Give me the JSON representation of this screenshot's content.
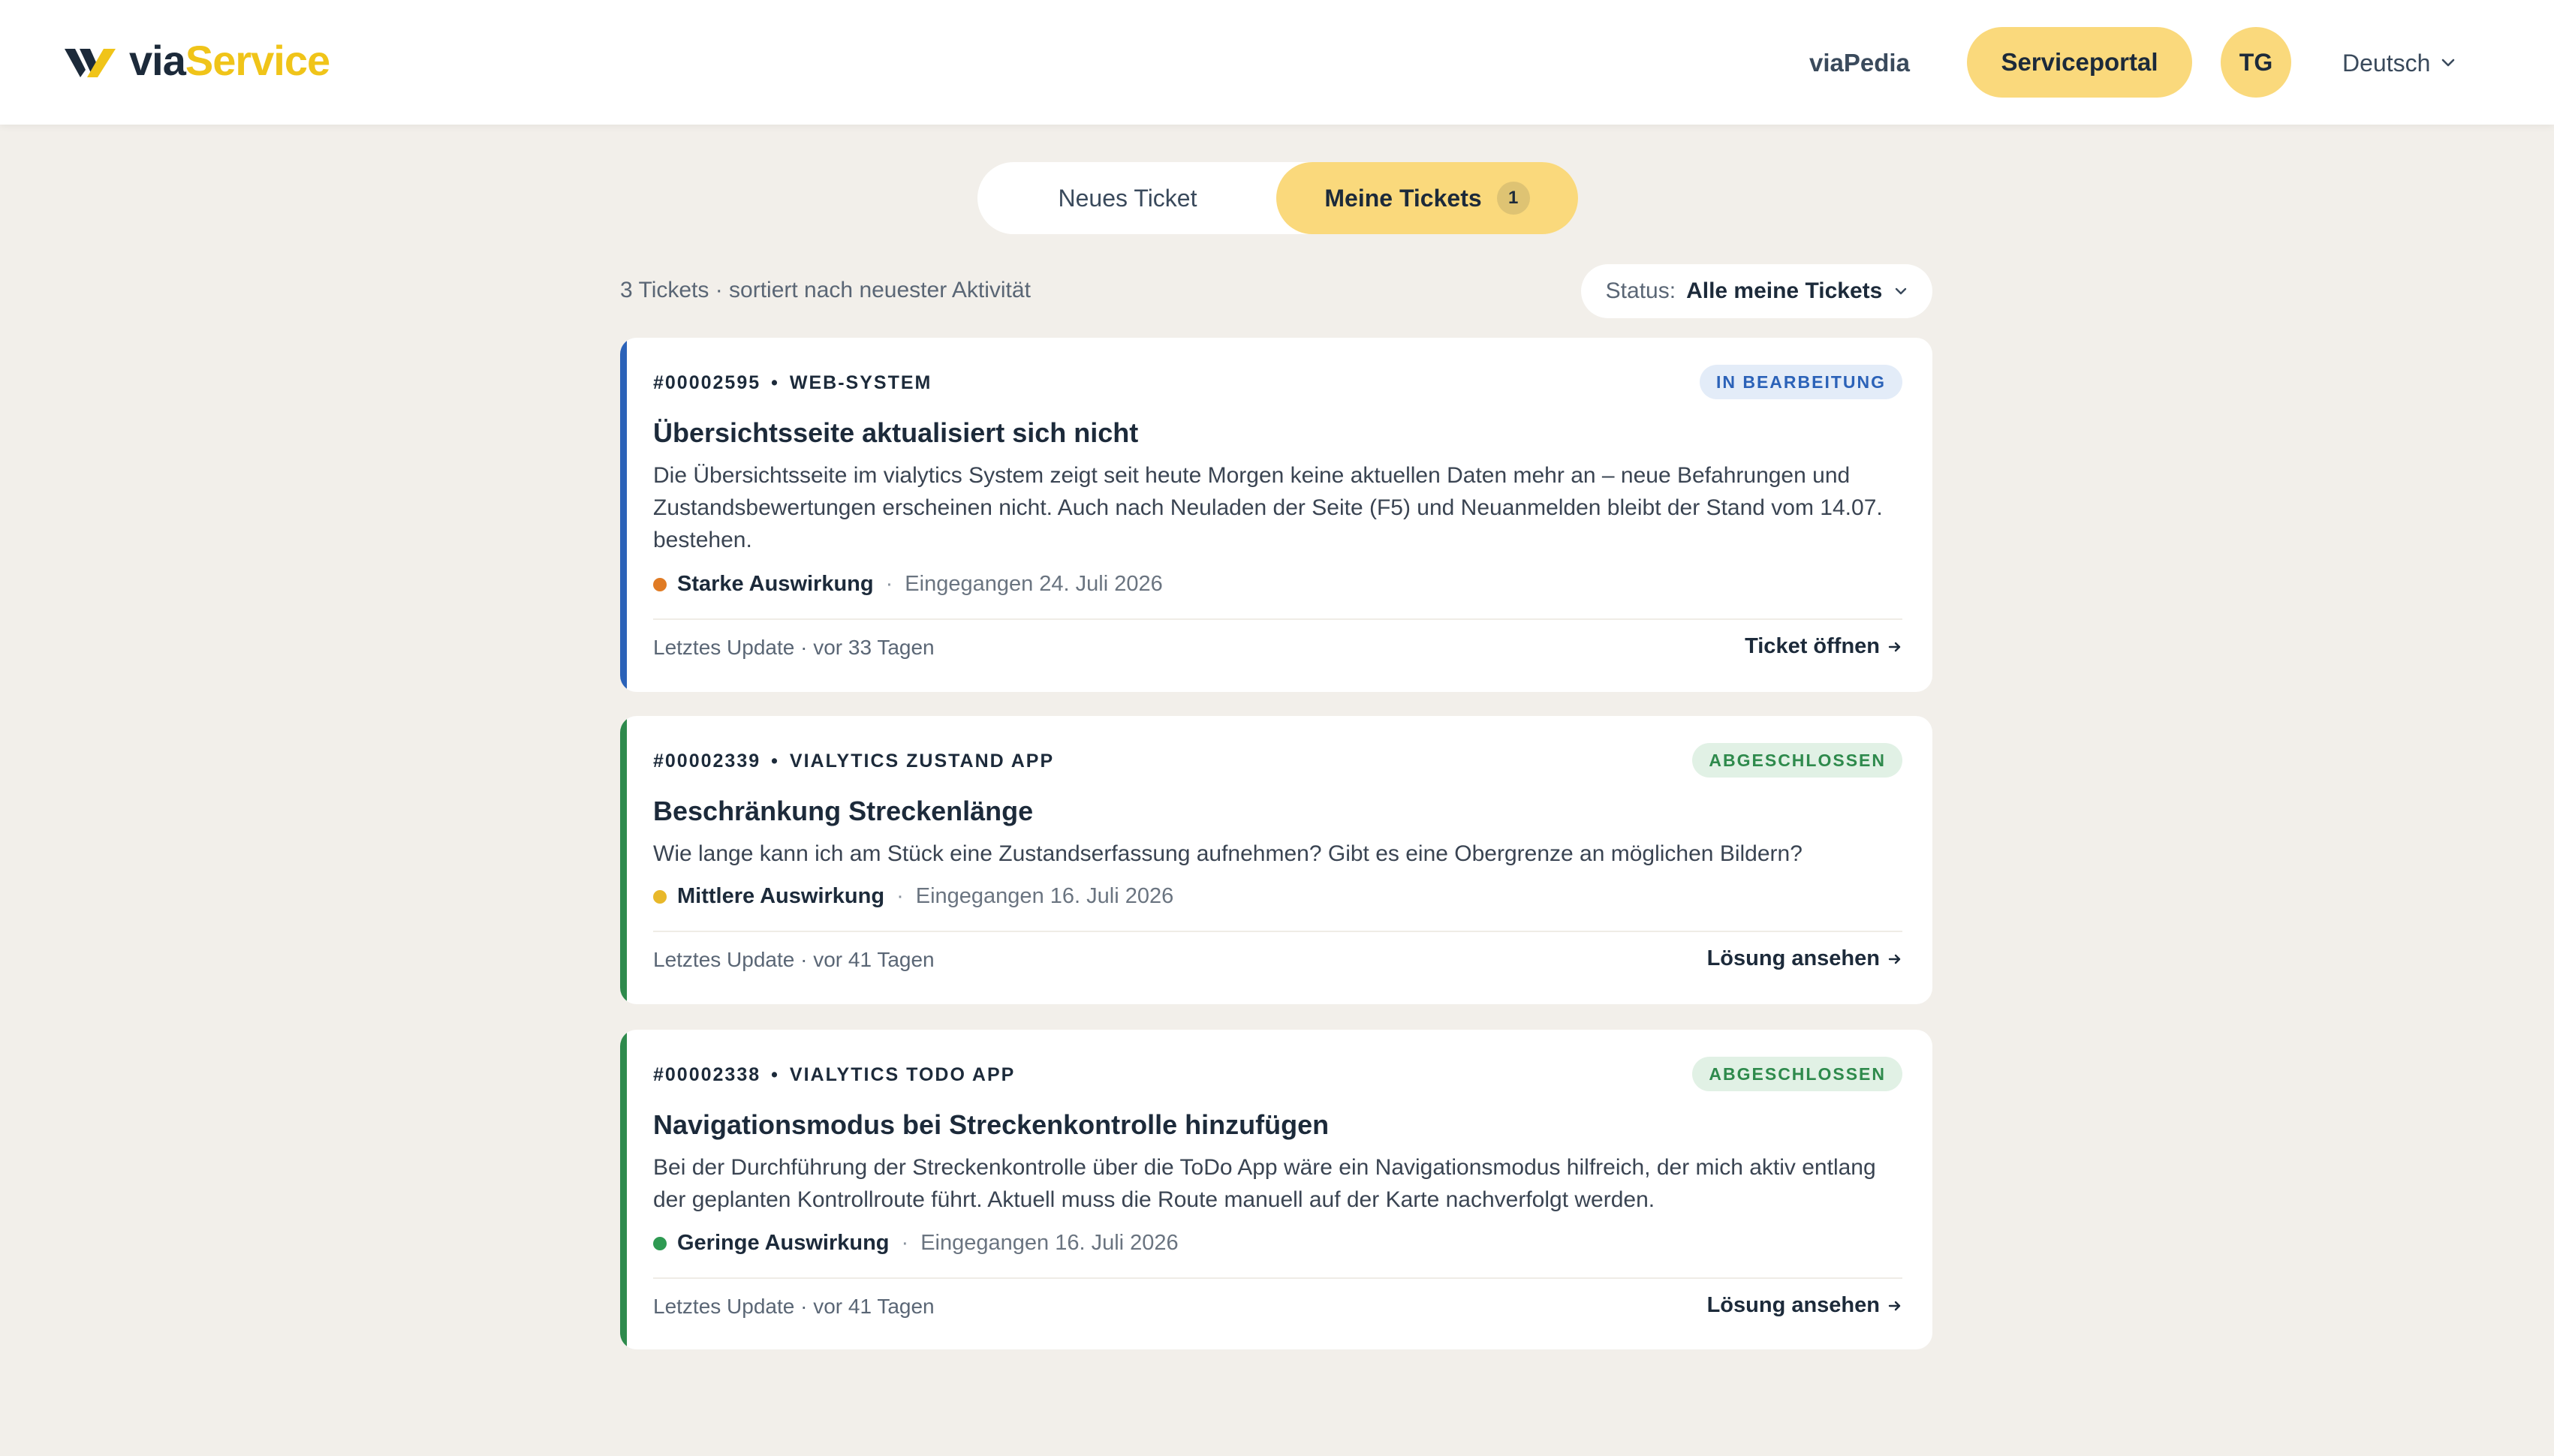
{
  "header": {
    "logo_via": "via",
    "logo_service": "Service",
    "nav_viapedia": "viaPedia",
    "nav_serviceportal": "Serviceportal",
    "avatar_initials": "TG",
    "language": "Deutsch"
  },
  "tabs": {
    "new_ticket": "Neues Ticket",
    "my_tickets": "Meine Tickets",
    "my_tickets_count": "1"
  },
  "list": {
    "summary": "3 Tickets · sortiert nach neuester Aktivität",
    "status_label": "Status:",
    "status_value": "Alle meine Tickets"
  },
  "colors": {
    "accent_yellow": "#fad97c",
    "brand_yellow": "#f0c419",
    "stripe_blue": "#2b62b8",
    "stripe_green": "#2e8a4c",
    "impact_high": "#e07b24",
    "impact_medium": "#e8b82a",
    "impact_low": "#2e9a52"
  },
  "tickets": [
    {
      "id": "#00002595",
      "category": "WEB-SYSTEM",
      "status": "IN BEARBEITUNG",
      "title": "Übersichtsseite aktualisiert sich nicht",
      "description": "Die Übersichtsseite im vialytics System zeigt seit heute Morgen keine aktuellen Daten mehr an – neue Befahrungen und Zustandsbewertungen erscheinen nicht. Auch nach Neuladen der Seite (F5) und Neuanmelden bleibt der Stand vom 14.07. bestehen.",
      "impact": "Starke Auswirkung",
      "received": "Eingegangen 24. Juli 2026",
      "updated": "Letztes Update · vor 33 Tagen",
      "action": "Ticket öffnen"
    },
    {
      "id": "#00002339",
      "category": "VIALYTICS ZUSTAND APP",
      "status": "ABGESCHLOSSEN",
      "title": "Beschränkung Streckenlänge",
      "description": "Wie lange kann ich am Stück eine Zustandserfassung aufnehmen? Gibt es eine Obergrenze an möglichen Bildern?",
      "impact": "Mittlere Auswirkung",
      "received": "Eingegangen 16. Juli 2026",
      "updated": "Letztes Update · vor 41 Tagen",
      "action": "Lösung ansehen"
    },
    {
      "id": "#00002338",
      "category": "VIALYTICS TODO APP",
      "status": "ABGESCHLOSSEN",
      "title": "Navigationsmodus bei Streckenkontrolle hinzufügen",
      "description": "Bei der Durchführung der Streckenkontrolle über die ToDo App wäre ein Navigationsmodus hilfreich, der mich aktiv entlang der geplanten Kontrollroute führt. Aktuell muss die Route manuell auf der Karte nachverfolgt werden.",
      "impact": "Geringe Auswirkung",
      "received": "Eingegangen 16. Juli 2026",
      "updated": "Letztes Update · vor 41 Tagen",
      "action": "Lösung ansehen"
    }
  ]
}
